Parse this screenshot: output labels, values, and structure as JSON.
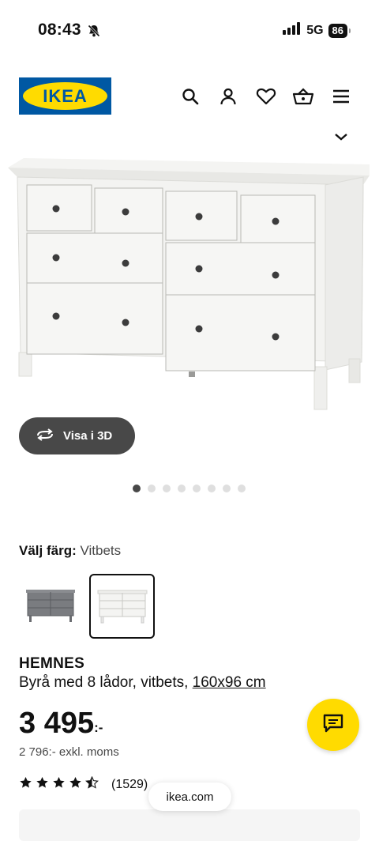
{
  "status": {
    "time": "08:43",
    "network": "5G",
    "battery": "86"
  },
  "header": {
    "logo_text": "IKEA",
    "icons": [
      "search-icon",
      "profile-icon",
      "heart-icon",
      "basket-icon",
      "menu-icon"
    ]
  },
  "gallery": {
    "view3d_label": "Visa i 3D",
    "dots_total": 8,
    "active_dot": 1
  },
  "color": {
    "label": "Välj färg:",
    "value": "Vitbets"
  },
  "product": {
    "name": "HEMNES",
    "description": "Byrå med 8 lådor, vitbets, ",
    "size_link": "160x96 cm",
    "price": "3 495",
    "price_suffix": ":-",
    "price_ex_vat": "2 796:- exkl. moms",
    "rating": 4.5,
    "review_count": "(1529)"
  },
  "browser": {
    "url": "ikea.com"
  },
  "colors": {
    "ikea_blue": "#0058a3",
    "ikea_yellow": "#ffdb00",
    "dark_button": "#484848"
  }
}
